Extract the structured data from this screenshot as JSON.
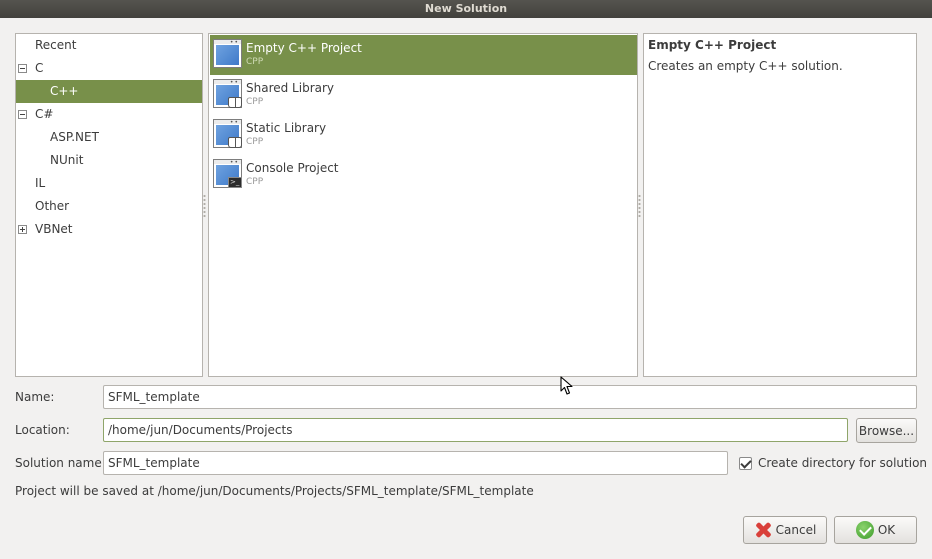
{
  "window": {
    "title": "New Solution"
  },
  "categories": [
    {
      "label": "Recent",
      "expander": "none",
      "indent": 0,
      "selected": false
    },
    {
      "label": "C",
      "expander": "expanded",
      "indent": 0,
      "selected": false
    },
    {
      "label": "C++",
      "expander": "none",
      "indent": 1,
      "selected": true
    },
    {
      "label": "C#",
      "expander": "expanded",
      "indent": 0,
      "selected": false
    },
    {
      "label": "ASP.NET",
      "expander": "none",
      "indent": 1,
      "selected": false
    },
    {
      "label": "NUnit",
      "expander": "none",
      "indent": 1,
      "selected": false
    },
    {
      "label": "IL",
      "expander": "none",
      "indent": 0,
      "selected": false
    },
    {
      "label": "Other",
      "expander": "none",
      "indent": 0,
      "selected": false
    },
    {
      "label": "VBNet",
      "expander": "collapsed",
      "indent": 0,
      "selected": false
    }
  ],
  "templates": [
    {
      "name": "Empty C++ Project",
      "language": "CPP",
      "icon": "empty-project-icon",
      "selected": true
    },
    {
      "name": "Shared Library",
      "language": "CPP",
      "icon": "shared-library-icon",
      "selected": false
    },
    {
      "name": "Static Library",
      "language": "CPP",
      "icon": "static-library-icon",
      "selected": false
    },
    {
      "name": "Console Project",
      "language": "CPP",
      "icon": "console-project-icon",
      "selected": false
    }
  ],
  "description": {
    "title": "Empty C++ Project",
    "text": "Creates an empty C++ solution."
  },
  "form": {
    "name_label": "Name:",
    "name_value": "SFML_template",
    "location_label": "Location:",
    "location_value": "/home/jun/Documents/Projects",
    "browse_label": "Browse...",
    "solution_name_label": "Solution name:",
    "solution_name_value": "SFML_template",
    "create_directory_label": "Create directory for solution",
    "create_directory_checked": true,
    "save_path_text": "Project will be saved at /home/jun/Documents/Projects/SFML_template/SFML_template"
  },
  "buttons": {
    "cancel_label": "Cancel",
    "ok_label": "OK"
  },
  "colors": {
    "selection": "#78904a",
    "titlebar": "#4a4945",
    "background": "#f2f1f0"
  }
}
